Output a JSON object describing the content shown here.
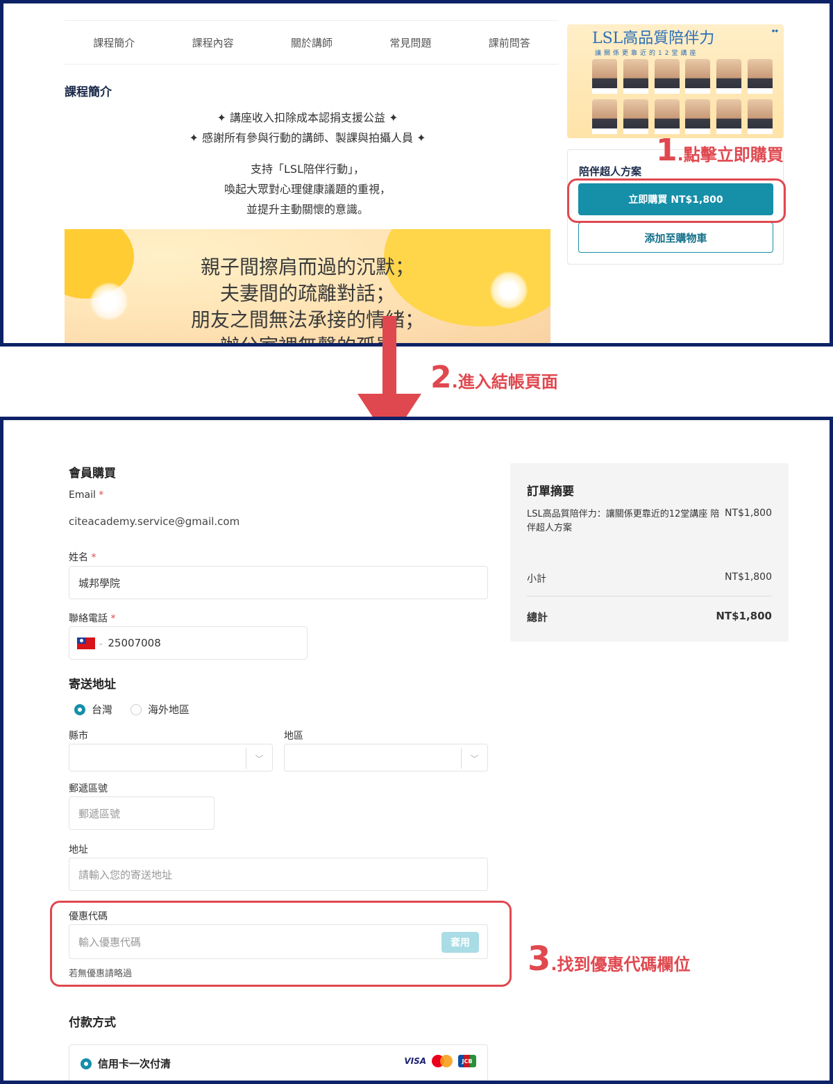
{
  "top": {
    "nav_tabs": [
      "課程簡介",
      "課程內容",
      "關於講師",
      "常見問題",
      "課前問答"
    ],
    "section_title": "課程簡介",
    "intro_lines": [
      "✦ 講座收入扣除成本認捐支援公益 ✦",
      "✦ 感謝所有參與行動的講師、製課與拍攝人員 ✦",
      "支持「LSL陪伴行動」，",
      "喚起大眾對心理健康議題的重視，",
      "並提升主動關懷的意識。"
    ],
    "banner_lines": [
      "親子間擦肩而過的沉默；",
      "夫妻間的疏離對話；",
      "朋友之間無法承接的情緒；",
      "辦公室裡無聲的孤單"
    ],
    "poster": {
      "title": "LSL高品質陪伴力",
      "subtitle": "讓關係更靠近的12堂講座"
    },
    "plan": {
      "name": "陪伴超人方案",
      "buy_label": "立即購買 NT$1,800",
      "cart_label": "添加至購物車"
    }
  },
  "steps": {
    "step1_num": "1",
    "step1_text": ".點擊立即購買",
    "step2_num": "2",
    "step2_text": ".進入結帳頁面",
    "step3_num": "3",
    "step3_text": ".找到優惠代碼欄位"
  },
  "checkout": {
    "member_heading": "會員購買",
    "email_label": "Email",
    "required_mark": "*",
    "email_value": "citeacademy.service@gmail.com",
    "name_label": "姓名",
    "name_value": "城邦學院",
    "phone_label": "聯絡電話",
    "phone_value": "25007008",
    "address_heading": "寄送地址",
    "region_options": [
      "台灣",
      "海外地區"
    ],
    "region_selected": "台灣",
    "city_label": "縣市",
    "district_label": "地區",
    "zip_label": "郵遞區號",
    "zip_placeholder": "郵遞區號",
    "address_label": "地址",
    "address_placeholder": "請輸入您的寄送地址",
    "coupon_label": "優惠代碼",
    "coupon_placeholder": "輸入優惠代碼",
    "apply_label": "套用",
    "coupon_hint": "若無優惠請略過",
    "payment_heading": "付款方式",
    "payment_option": "信用卡一次付清",
    "card_brands": [
      "VISA",
      "Mastercard",
      "JCB"
    ]
  },
  "summary": {
    "title": "訂單摘要",
    "item_name": "LSL高品質陪伴力：讓關係更靠近的12堂講座 陪伴超人方案",
    "item_price": "NT$1,800",
    "subtotal_label": "小計",
    "subtotal_value": "NT$1,800",
    "total_label": "總計",
    "total_value": "NT$1,800"
  },
  "colors": {
    "accent": "#168fa8",
    "annotation_red": "#e0484f",
    "frame_navy": "#0d2266"
  }
}
